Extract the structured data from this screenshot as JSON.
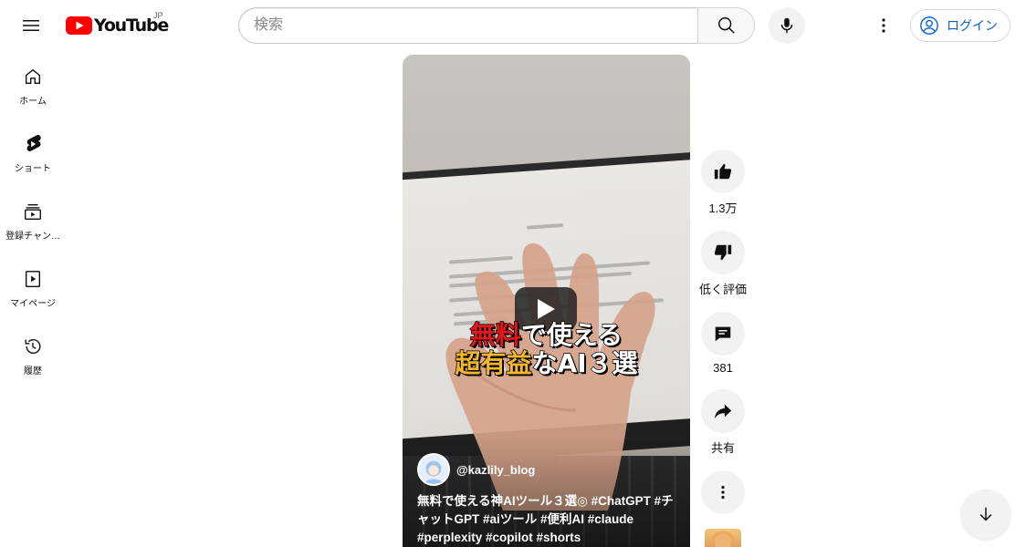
{
  "header": {
    "logo_text": "YouTube",
    "country_code": "JP",
    "search_placeholder": "検索",
    "login_label": "ログイン"
  },
  "sidebar": {
    "items": [
      {
        "label": "ホーム",
        "icon": "home-icon"
      },
      {
        "label": "ショート",
        "icon": "shorts-icon"
      },
      {
        "label": "登録チャン…",
        "icon": "subscriptions-icon"
      },
      {
        "label": "マイページ",
        "icon": "you-icon"
      },
      {
        "label": "履歴",
        "icon": "history-icon"
      }
    ]
  },
  "video": {
    "overlay_line1_red": "無料",
    "overlay_line1_rest": "で使える",
    "overlay_line2_yellow": "超有益",
    "overlay_line2_rest": "なAI３選",
    "channel_name": "@kazlily_blog",
    "description": "無料で使える神AIツール３選◎ #ChatGPT #チャットGPT #aiツール #便利AI #claude #perplexity #copilot #shorts"
  },
  "actions": {
    "like_count": "1.3万",
    "dislike_label": "低く評価",
    "comment_count": "381",
    "share_label": "共有"
  },
  "colors": {
    "brand_red": "#ff0000",
    "link_blue": "#065fd4",
    "chip_gray": "#f2f2f2"
  }
}
